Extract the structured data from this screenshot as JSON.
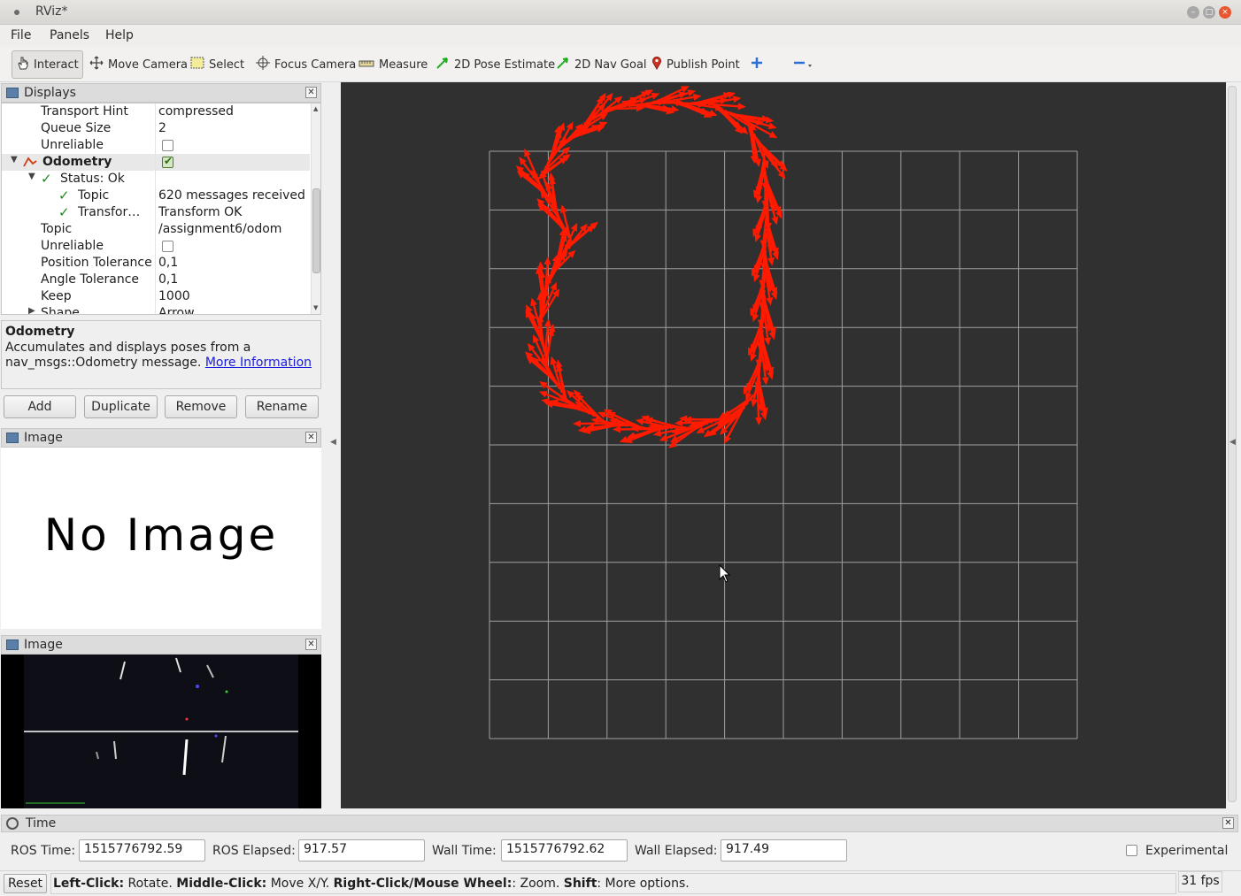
{
  "window": {
    "title": "RViz*"
  },
  "menu": {
    "file": "File",
    "panels": "Panels",
    "help": "Help"
  },
  "toolbar": {
    "interact": "Interact",
    "move_camera": "Move Camera",
    "select": "Select",
    "focus_camera": "Focus Camera",
    "measure": "Measure",
    "pose_estimate": "2D Pose Estimate",
    "nav_goal": "2D Nav Goal",
    "publish_point": "Publish Point"
  },
  "displays": {
    "title": "Displays",
    "rows": [
      {
        "key": "Transport Hint",
        "value": "compressed"
      },
      {
        "key": "Queue Size",
        "value": "2"
      },
      {
        "key": "Unreliable",
        "value": ""
      },
      {
        "key": "Odometry",
        "value": ""
      },
      {
        "key": "Status: Ok",
        "value": ""
      },
      {
        "key": "Topic",
        "value": "620 messages received"
      },
      {
        "key": "Transfor…",
        "value": "Transform OK"
      },
      {
        "key": "Topic",
        "value": "/assignment6/odom"
      },
      {
        "key": "Unreliable",
        "value": ""
      },
      {
        "key": "Position Tolerance",
        "value": "0,1"
      },
      {
        "key": "Angle Tolerance",
        "value": "0,1"
      },
      {
        "key": "Keep",
        "value": "1000"
      },
      {
        "key": "Shape",
        "value": "Arrow"
      }
    ],
    "description": {
      "title": "Odometry",
      "text": "Accumulates and displays poses from a nav_msgs::Odometry message.",
      "link": "More Information"
    },
    "buttons": {
      "add": "Add",
      "duplicate": "Duplicate",
      "remove": "Remove",
      "rename": "Rename"
    }
  },
  "image_panel_1": {
    "title": "Image",
    "placeholder": "No Image"
  },
  "image_panel_2": {
    "title": "Image"
  },
  "view": {
    "background": "#303030",
    "grid_color": "#a0a0a0",
    "arrow_color": "#ff1a00",
    "grid_cells": 10
  },
  "time": {
    "title": "Time",
    "ros_time_label": "ROS Time:",
    "ros_time": "1515776792.59",
    "ros_elapsed_label": "ROS Elapsed:",
    "ros_elapsed": "917.57",
    "wall_time_label": "Wall Time:",
    "wall_time": "1515776792.62",
    "wall_elapsed_label": "Wall Elapsed:",
    "wall_elapsed": "917.49",
    "experimental": "Experimental"
  },
  "status": {
    "reset": "Reset",
    "h1": "Left-Click:",
    "t1": " Rotate. ",
    "h2": "Middle-Click:",
    "t2": " Move X/Y. ",
    "h3": "Right-Click/Mouse Wheel:",
    "t3": ": Zoom. ",
    "h4": "Shift",
    "t4": ": More options.",
    "fps": "31 fps"
  }
}
